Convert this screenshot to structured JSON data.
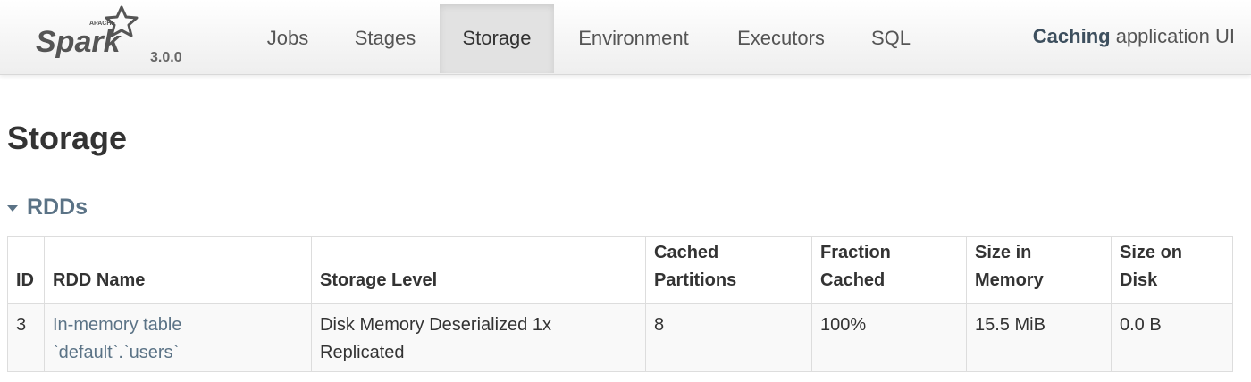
{
  "navbar": {
    "brand": {
      "top_text": "APACHE",
      "name": "Spark",
      "version": "3.0.0"
    },
    "tabs": [
      {
        "label": "Jobs",
        "active": false
      },
      {
        "label": "Stages",
        "active": false
      },
      {
        "label": "Storage",
        "active": true
      },
      {
        "label": "Environment",
        "active": false
      },
      {
        "label": "Executors",
        "active": false
      },
      {
        "label": "SQL",
        "active": false
      }
    ],
    "app_name": "Caching",
    "app_suffix": " application UI"
  },
  "page": {
    "title": "Storage",
    "section": {
      "label": "RDDs",
      "expanded": true
    }
  },
  "table": {
    "headers": [
      "ID",
      "RDD Name",
      "Storage Level",
      "Cached\nPartitions",
      "Fraction\nCached",
      "Size in\nMemory",
      "Size on\nDisk"
    ],
    "rows": [
      {
        "id": "3",
        "rdd_name": "In-memory table\n`default`.`users`",
        "storage_level": "Disk Memory Deserialized 1x\nReplicated",
        "cached_partitions": "8",
        "fraction_cached": "100%",
        "size_in_memory": "15.5 MiB",
        "size_on_disk": "0.0 B"
      }
    ]
  },
  "colors": {
    "link": "#5b7386",
    "active_tab_bg": "#e2e2e2",
    "brand_orange": "#e25a1c"
  }
}
